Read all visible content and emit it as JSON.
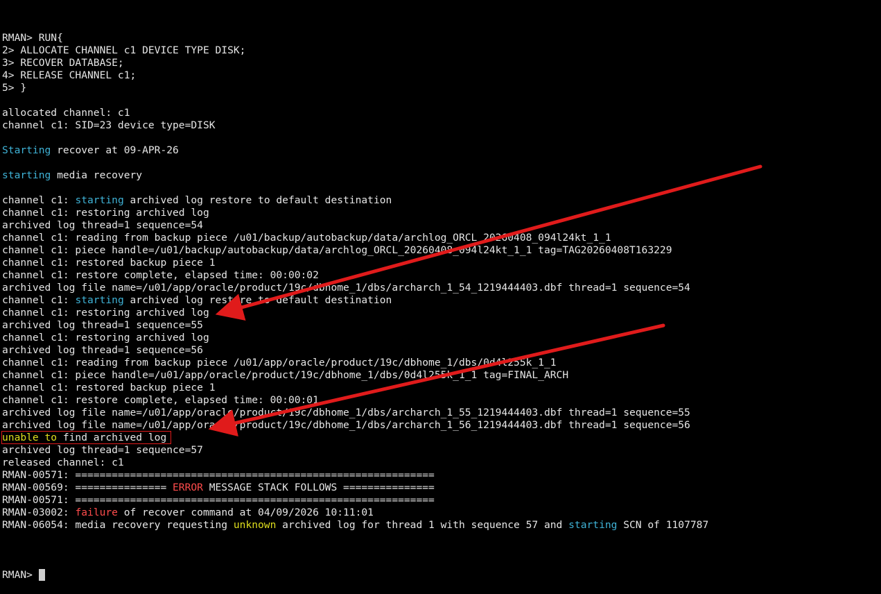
{
  "terminal": {
    "prompt": "RMAN> ",
    "lines": [
      {
        "segments": [
          {
            "text": "RMAN> RUN{",
            "color": "default"
          }
        ]
      },
      {
        "segments": [
          {
            "text": "2> ALLOCATE CHANNEL c1 DEVICE TYPE DISK;",
            "color": "default"
          }
        ]
      },
      {
        "segments": [
          {
            "text": "3> RECOVER DATABASE;",
            "color": "default"
          }
        ]
      },
      {
        "segments": [
          {
            "text": "4> RELEASE CHANNEL c1;",
            "color": "default"
          }
        ]
      },
      {
        "segments": [
          {
            "text": "5> }",
            "color": "default"
          }
        ]
      },
      {
        "segments": [
          {
            "text": "",
            "color": "default"
          }
        ]
      },
      {
        "segments": [
          {
            "text": "allocated channel: c1",
            "color": "default"
          }
        ]
      },
      {
        "segments": [
          {
            "text": "channel c1: SID=23 device type=DISK",
            "color": "default"
          }
        ]
      },
      {
        "segments": [
          {
            "text": "",
            "color": "default"
          }
        ]
      },
      {
        "segments": [
          {
            "text": "Starting",
            "color": "cyan"
          },
          {
            "text": " recover at 09-APR-26",
            "color": "default"
          }
        ]
      },
      {
        "segments": [
          {
            "text": "",
            "color": "default"
          }
        ]
      },
      {
        "segments": [
          {
            "text": "starting",
            "color": "cyan"
          },
          {
            "text": " media recovery",
            "color": "default"
          }
        ]
      },
      {
        "segments": [
          {
            "text": "",
            "color": "default"
          }
        ]
      },
      {
        "segments": [
          {
            "text": "channel c1: ",
            "color": "default"
          },
          {
            "text": "starting",
            "color": "cyan"
          },
          {
            "text": " archived log restore to default destination",
            "color": "default"
          }
        ]
      },
      {
        "segments": [
          {
            "text": "channel c1: restoring archived log",
            "color": "default"
          }
        ]
      },
      {
        "segments": [
          {
            "text": "archived log thread=1 sequence=54",
            "color": "default"
          }
        ]
      },
      {
        "segments": [
          {
            "text": "channel c1: reading from backup piece /u01/backup/autobackup/data/archlog_ORCL_20260408_094l24kt_1_1",
            "color": "default"
          }
        ]
      },
      {
        "segments": [
          {
            "text": "channel c1: piece handle=/u01/backup/autobackup/data/archlog_ORCL_20260408_094l24kt_1_1 tag=TAG20260408T163229",
            "color": "default"
          }
        ]
      },
      {
        "segments": [
          {
            "text": "channel c1: restored backup piece 1",
            "color": "default"
          }
        ]
      },
      {
        "segments": [
          {
            "text": "channel c1: restore complete, elapsed time: 00:00:02",
            "color": "default"
          }
        ]
      },
      {
        "segments": [
          {
            "text": "archived log file name=/u01/app/oracle/product/19c/dbhome_1/dbs/archarch_1_54_1219444403.dbf thread=1 sequence=54",
            "color": "default"
          }
        ]
      },
      {
        "segments": [
          {
            "text": "channel c1: ",
            "color": "default"
          },
          {
            "text": "starting",
            "color": "cyan"
          },
          {
            "text": " archived log restore to default destination",
            "color": "default"
          }
        ]
      },
      {
        "segments": [
          {
            "text": "channel c1: restoring archived log",
            "color": "default"
          }
        ]
      },
      {
        "segments": [
          {
            "text": "archived log thread=1 sequence=55",
            "color": "default"
          }
        ]
      },
      {
        "segments": [
          {
            "text": "channel c1: restoring archived log",
            "color": "default"
          }
        ]
      },
      {
        "segments": [
          {
            "text": "archived log thread=1 sequence=56",
            "color": "default"
          }
        ]
      },
      {
        "segments": [
          {
            "text": "channel c1: reading from backup piece /u01/app/oracle/product/19c/dbhome_1/dbs/0d4l255k_1_1",
            "color": "default"
          }
        ]
      },
      {
        "segments": [
          {
            "text": "channel c1: piece handle=/u01/app/oracle/product/19c/dbhome_1/dbs/0d4l255k_1_1 tag=FINAL_ARCH",
            "color": "default"
          }
        ]
      },
      {
        "segments": [
          {
            "text": "channel c1: restored backup piece 1",
            "color": "default"
          }
        ]
      },
      {
        "segments": [
          {
            "text": "channel c1: restore complete, elapsed time: 00:00:01",
            "color": "default"
          }
        ]
      },
      {
        "segments": [
          {
            "text": "archived log file name=/u01/app/oracle/product/19c/dbhome_1/dbs/archarch_1_55_1219444403.dbf thread=1 sequence=55",
            "color": "default"
          }
        ]
      },
      {
        "segments": [
          {
            "text": "archived log file name=/u01/app/oracle/product/19c/dbhome_1/dbs/archarch_1_56_1219444403.dbf thread=1 sequence=56",
            "color": "default"
          }
        ]
      },
      {
        "segments": [
          {
            "text": "unable to",
            "color": "yellow"
          },
          {
            "text": " find archived log",
            "color": "default"
          }
        ],
        "boxed": true
      },
      {
        "segments": [
          {
            "text": "archived log thread=1 sequence=57",
            "color": "default"
          }
        ]
      },
      {
        "segments": [
          {
            "text": "released channel: c1",
            "color": "default"
          }
        ]
      },
      {
        "segments": [
          {
            "text": "RMAN-00571: ===========================================================",
            "color": "default"
          }
        ]
      },
      {
        "segments": [
          {
            "text": "RMAN-00569: =============== ",
            "color": "default"
          },
          {
            "text": "ERROR",
            "color": "red"
          },
          {
            "text": " MESSAGE STACK FOLLOWS ===============",
            "color": "default"
          }
        ]
      },
      {
        "segments": [
          {
            "text": "RMAN-00571: ===========================================================",
            "color": "default"
          }
        ]
      },
      {
        "segments": [
          {
            "text": "RMAN-03002: ",
            "color": "default"
          },
          {
            "text": "failure",
            "color": "red"
          },
          {
            "text": " of recover command at 04/09/2026 10:11:01",
            "color": "default"
          }
        ]
      },
      {
        "segments": [
          {
            "text": "RMAN-06054: media recovery requesting ",
            "color": "default"
          },
          {
            "text": "unknown",
            "color": "yellow"
          },
          {
            "text": " archived log for thread 1 with sequence 57 and ",
            "color": "default"
          },
          {
            "text": "starting",
            "color": "cyan"
          },
          {
            "text": " SCN of 1107787",
            "color": "default"
          }
        ]
      },
      {
        "segments": [
          {
            "text": "",
            "color": "default"
          }
        ]
      }
    ]
  },
  "colors": {
    "background": "#000000",
    "text": "#e6e6e6",
    "cyan": "#3fb2d6",
    "red": "#ff4c4c",
    "yellow": "#dede1e",
    "annotation": "#e01b1b"
  },
  "annotations": {
    "arrows": [
      "arrow-to-sequence-55",
      "arrow-to-sequence-57"
    ],
    "highlight": "unable-to-find-archived-log-box"
  }
}
